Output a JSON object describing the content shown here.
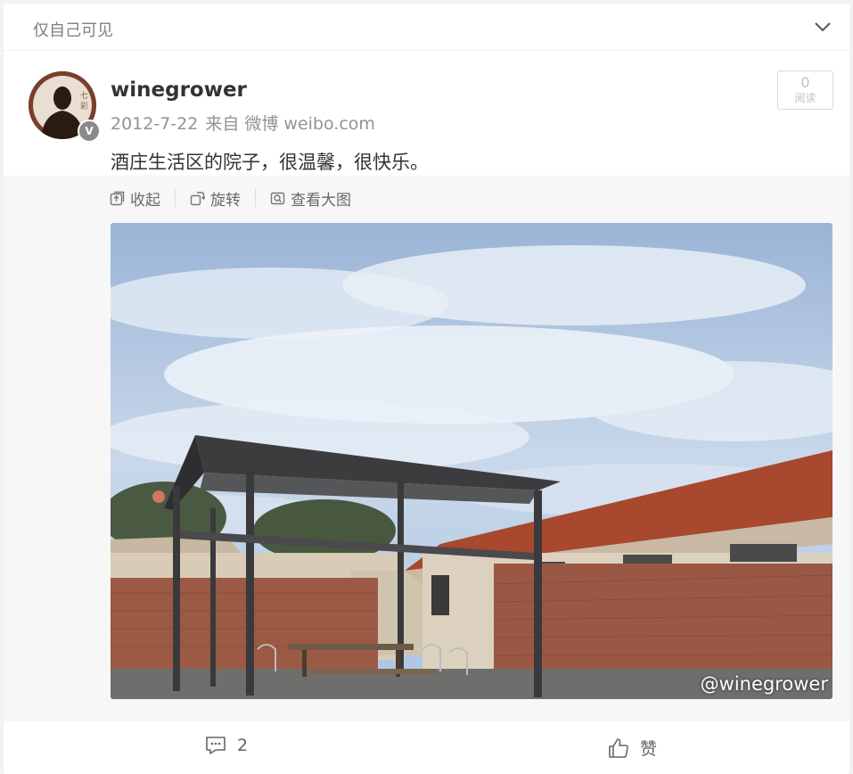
{
  "header": {
    "visibility_label": "仅自己可见",
    "expand_icon": "chevron-down-icon"
  },
  "post": {
    "username": "winegrower",
    "date": "2012-7-22",
    "source": "来自 微博 weibo.com",
    "verified_badge": "V",
    "read_count": "0",
    "read_label": "阅读",
    "text": "酒庄生活区的院子，很温馨，很快乐。"
  },
  "media": {
    "actions": [
      {
        "label": "收起",
        "icon": "collapse-icon"
      },
      {
        "label": "旋转",
        "icon": "rotate-icon"
      },
      {
        "label": "查看大图",
        "icon": "view-large-icon"
      }
    ],
    "watermark": "@winegrower"
  },
  "footer": {
    "comment_count": "2",
    "like_label": "赞"
  },
  "colors": {
    "background": "#f2f2f2",
    "card": "#ffffff",
    "text_primary": "#333333",
    "text_secondary": "#939393",
    "media_bg": "#f7f7f7"
  }
}
